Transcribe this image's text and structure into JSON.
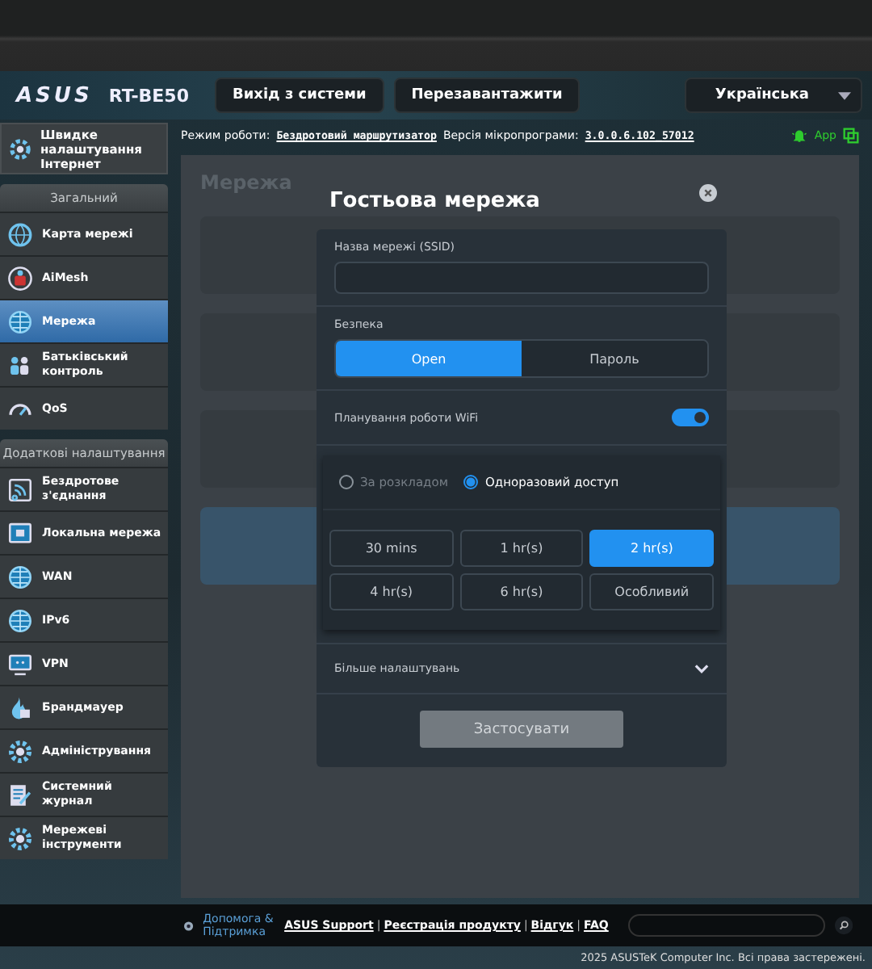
{
  "header": {
    "brand": "ASUS",
    "model": "RT-BE50",
    "buttons": [
      "Вихід з системи",
      "Перезавантажити"
    ],
    "language": "Українська"
  },
  "info_bar": {
    "mode_label": "Режим роботи:",
    "mode_value": "Бездротовий маршрутизатор",
    "firmware_label": "Версія мікропрограми:",
    "firmware_value": "3.0.0.6.102_57012",
    "app": "App"
  },
  "sidebar": {
    "quick_setup": {
      "label": "Швидке налаштування Інтернет",
      "kind": "wand"
    },
    "sections": [
      {
        "title": "Загальний",
        "items": [
          {
            "label": "Карта мережі",
            "kind": "map",
            "selected": false
          },
          {
            "label": "AiMesh",
            "kind": "mesh",
            "selected": false
          },
          {
            "label": "Мережа",
            "kind": "globe",
            "selected": true
          },
          {
            "label": "Батьківський контроль",
            "kind": "family",
            "selected": false
          },
          {
            "label": "QoS",
            "kind": "gauge",
            "selected": false
          }
        ]
      },
      {
        "title": "Додаткові налаштування",
        "items": [
          {
            "label": "Бездротове з'єднання",
            "kind": "wifi",
            "selected": false
          },
          {
            "label": "Локальна мережа",
            "kind": "lan",
            "selected": false
          },
          {
            "label": "WAN",
            "kind": "globe",
            "selected": false
          },
          {
            "label": "IPv6",
            "kind": "globe",
            "selected": false
          },
          {
            "label": "VPN",
            "kind": "vpn",
            "selected": false
          },
          {
            "label": "Брандмауер",
            "kind": "fire",
            "selected": false
          },
          {
            "label": "Адміністрування",
            "kind": "gear",
            "selected": false
          },
          {
            "label": "Системний журнал",
            "kind": "log",
            "selected": false
          },
          {
            "label": "Мережеві інструменти",
            "kind": "gear",
            "selected": false
          }
        ]
      }
    ]
  },
  "page": {
    "title": "Мережа"
  },
  "modal": {
    "title": "Гостьова мережа",
    "ssid_label": "Назва мережі (SSID)",
    "security_label": "Безпека",
    "security_options": [
      {
        "label": "Open",
        "selected": true
      },
      {
        "label": "Пароль",
        "selected": false
      }
    ],
    "schedule_label": "Планування роботи WiFi",
    "schedule_on": true,
    "modes": [
      {
        "label": "За розкладом",
        "selected": false
      },
      {
        "label": "Одноразовий доступ",
        "selected": true
      }
    ],
    "durations": [
      {
        "label": "30 mins",
        "selected": false
      },
      {
        "label": "1 hr(s)",
        "selected": false
      },
      {
        "label": "2 hr(s)",
        "selected": true
      },
      {
        "label": "4 hr(s)",
        "selected": false
      },
      {
        "label": "6 hr(s)",
        "selected": false
      },
      {
        "label": "Особливий",
        "selected": false
      }
    ],
    "more_label": "Більше налаштувань",
    "apply": {
      "label": "Застосувати",
      "disabled": true
    }
  },
  "footer": {
    "help": "Допомога & Підтримка",
    "links": [
      "ASUS Support",
      "Реєстрація продукту",
      "Відгук",
      "FAQ"
    ],
    "separator": "|",
    "copyright": "2025 ASUSTeK Computer Inc. Всі права застережені."
  }
}
